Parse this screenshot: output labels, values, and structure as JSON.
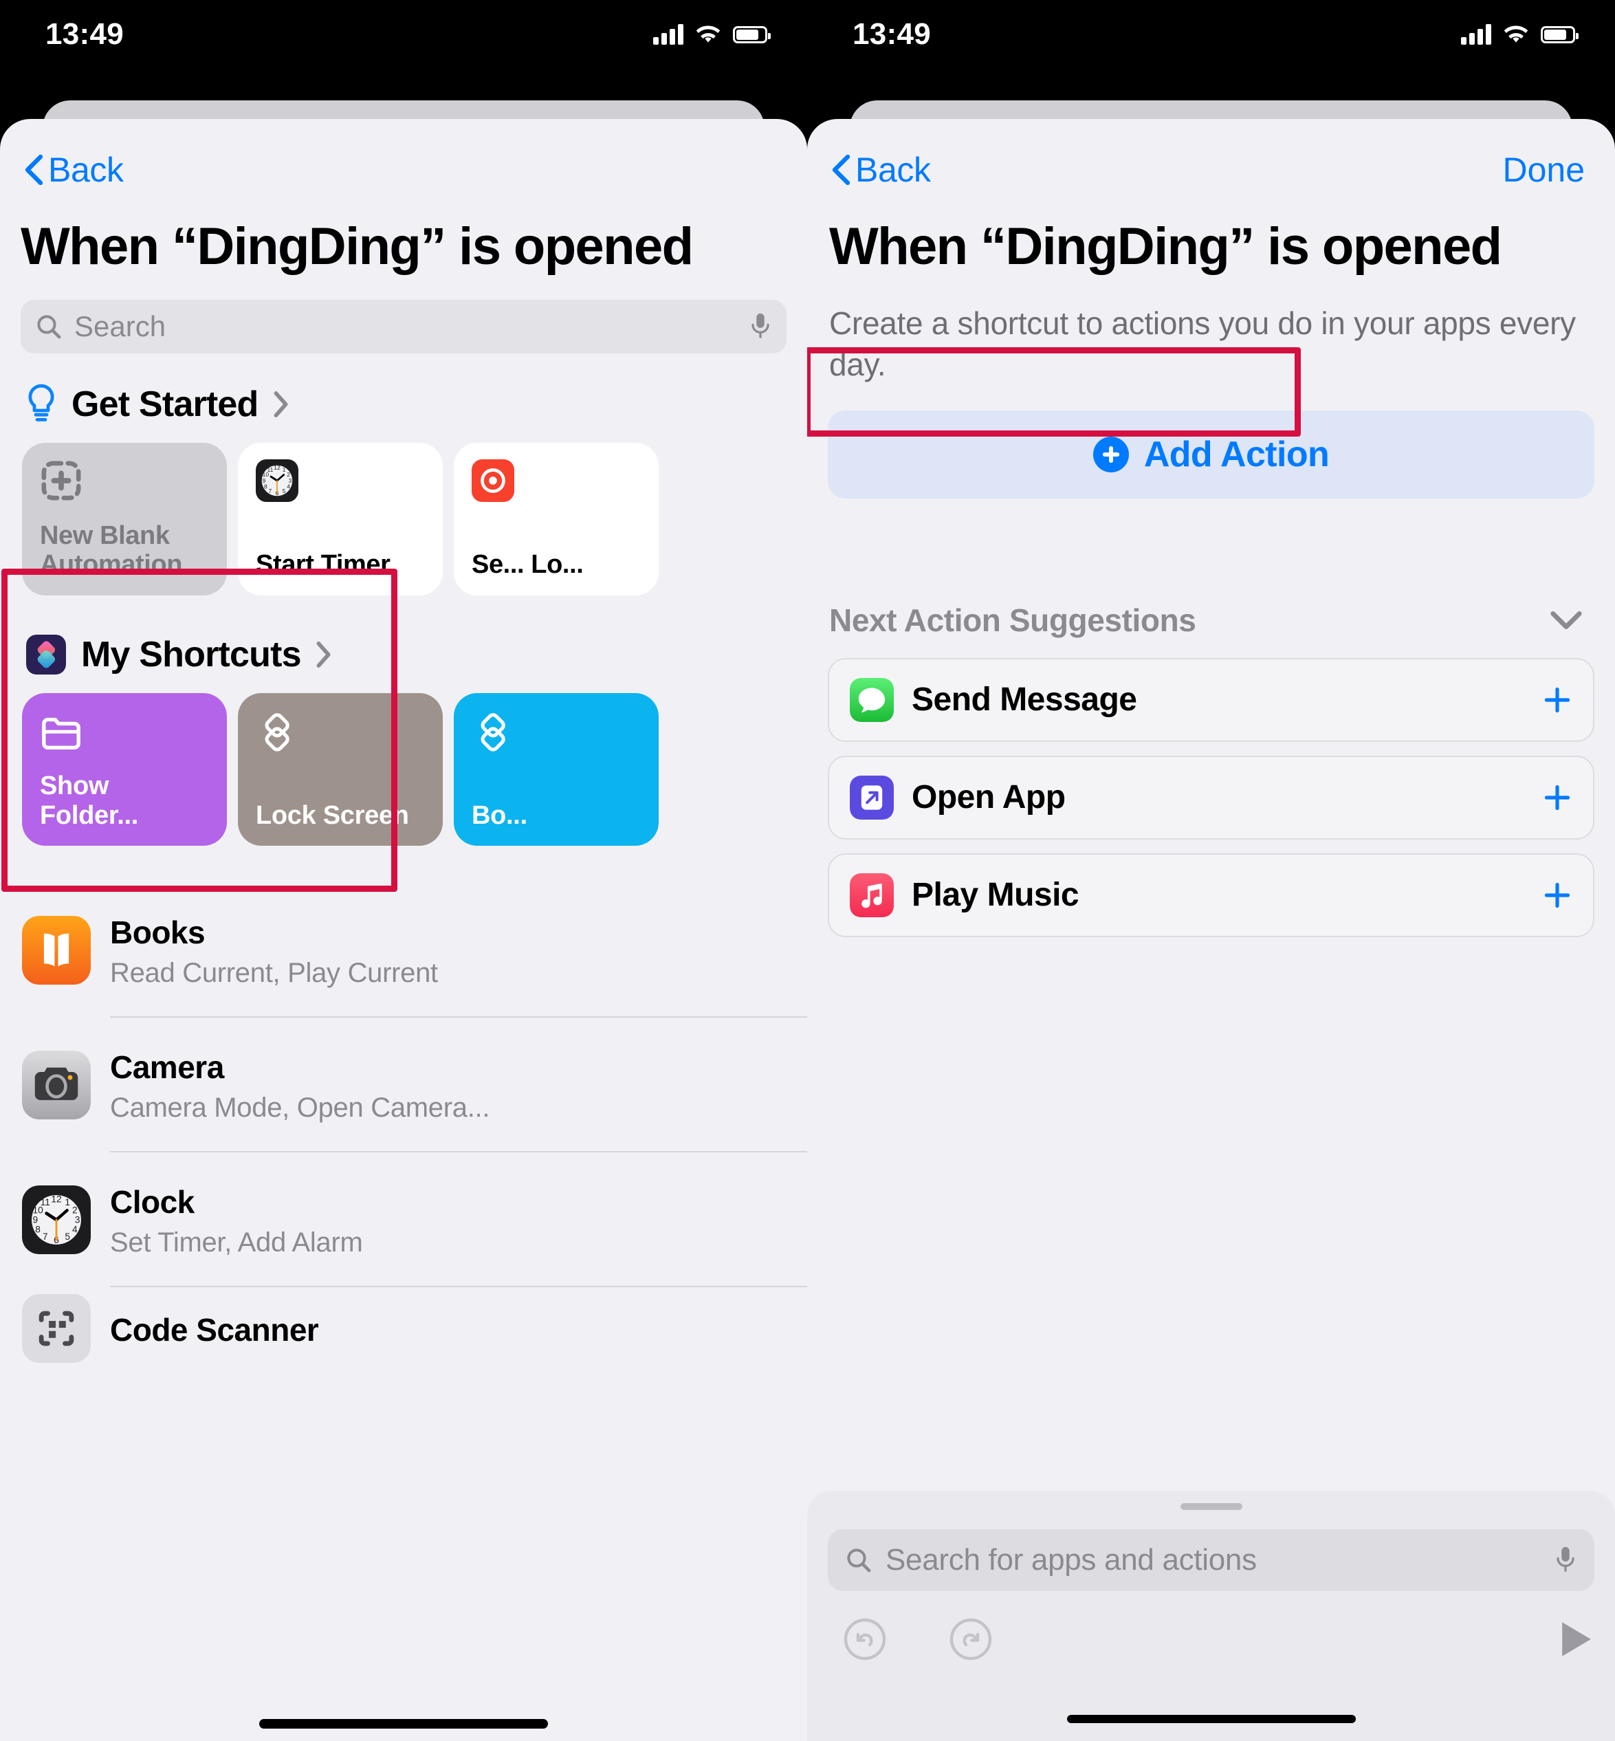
{
  "status_bar": {
    "time": "13:49",
    "signal_icon": "cellular-signal-icon",
    "wifi_icon": "wifi-icon",
    "battery_icon": "battery-icon"
  },
  "left_panel": {
    "nav": {
      "back_label": "Back",
      "back_icon": "chevron-left-icon"
    },
    "title": "When “DingDing” is opened",
    "search": {
      "placeholder": "Search",
      "search_icon": "search-icon",
      "mic_icon": "microphone-icon"
    },
    "get_started": {
      "icon": "lightbulb-icon",
      "label": "Get Started",
      "chevron": "chevron-right-icon",
      "cards": [
        {
          "label": "New Blank Automation",
          "icon": "dashed-plus-icon",
          "style": "blank",
          "highlighted": true
        },
        {
          "label": "Start Timer",
          "icon": "clock-app-icon",
          "style": "white",
          "highlighted": false
        },
        {
          "label": "Se... Lo...",
          "icon": "red-app-icon",
          "style": "white",
          "highlighted": false
        }
      ]
    },
    "my_shortcuts": {
      "icon": "shortcuts-app-icon",
      "label": "My Shortcuts",
      "chevron": "chevron-right-icon",
      "cards": [
        {
          "label": "Show Folder...",
          "icon": "folder-icon",
          "color": "#b464e8"
        },
        {
          "label": "Lock Screen",
          "icon": "layers-diamond-icon",
          "color": "#9e928d"
        },
        {
          "label": "Bo...",
          "icon": "layers-diamond-icon",
          "color": "#0bb3ef"
        }
      ]
    },
    "apps": [
      {
        "name": "Books",
        "subtitle": "Read Current, Play Current",
        "icon": "books-app-icon"
      },
      {
        "name": "Camera",
        "subtitle": "Camera Mode, Open Camera...",
        "icon": "camera-app-icon"
      },
      {
        "name": "Clock",
        "subtitle": "Set Timer, Add Alarm",
        "icon": "clock-app-icon"
      },
      {
        "name": "Code Scanner",
        "subtitle": "",
        "icon": "code-scanner-app-icon"
      }
    ]
  },
  "right_panel": {
    "nav": {
      "back_label": "Back",
      "back_icon": "chevron-left-icon",
      "done_label": "Done"
    },
    "title": "When “DingDing” is opened",
    "subtitle": "Create a shortcut to actions you do in your apps every day.",
    "add_action": {
      "label": "Add Action",
      "icon": "plus-circle-icon",
      "highlighted": true
    },
    "suggestions": {
      "header": "Next Action Suggestions",
      "collapse_icon": "chevron-down-icon",
      "items": [
        {
          "label": "Send Message",
          "icon": "messages-app-icon",
          "add_icon": "plus-icon"
        },
        {
          "label": "Open App",
          "icon": "open-app-icon",
          "add_icon": "plus-icon"
        },
        {
          "label": "Play Music",
          "icon": "music-app-icon",
          "add_icon": "plus-icon"
        }
      ]
    },
    "bottom_sheet": {
      "grabber": "drag-handle",
      "search_placeholder": "Search for apps and actions",
      "search_icon": "search-icon",
      "mic_icon": "microphone-icon",
      "undo_icon": "undo-icon",
      "redo_icon": "redo-icon",
      "play_icon": "play-icon"
    }
  },
  "colors": {
    "accent_blue": "#007aff",
    "highlight_red": "#d50f40",
    "sheet_bg": "#f1f1f5",
    "secondary_text": "#8a8a8f"
  }
}
